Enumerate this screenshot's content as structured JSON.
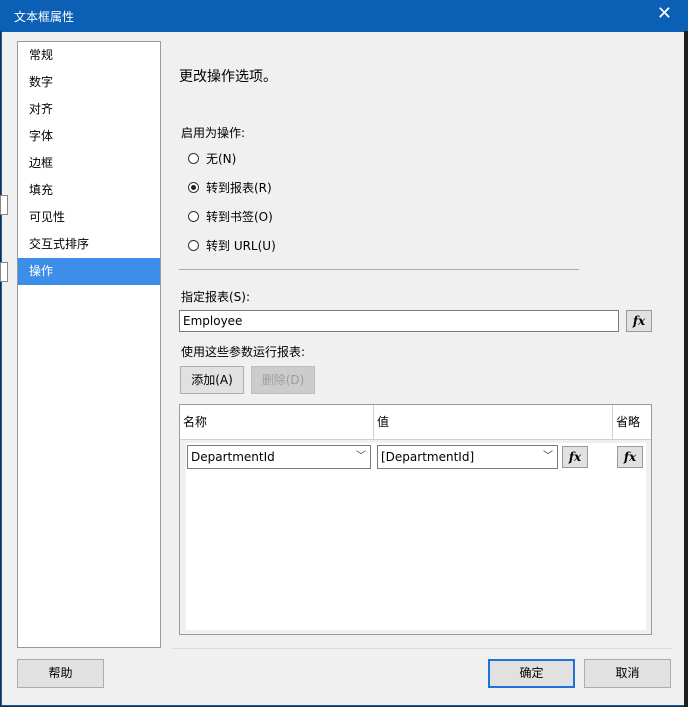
{
  "window": {
    "title": "文本框属性",
    "close_icon": "close-icon"
  },
  "sidebar": {
    "items": [
      {
        "label": "常规"
      },
      {
        "label": "数字"
      },
      {
        "label": "对齐"
      },
      {
        "label": "字体"
      },
      {
        "label": "边框"
      },
      {
        "label": "填充"
      },
      {
        "label": "可见性"
      },
      {
        "label": "交互式排序"
      },
      {
        "label": "操作",
        "selected": true
      }
    ]
  },
  "main": {
    "heading": "更改操作选项。",
    "enable_as_action_label": "启用为操作:",
    "radios": [
      {
        "label": "无(N)",
        "checked": false
      },
      {
        "label": "转到报表(R)",
        "checked": true
      },
      {
        "label": "转到书签(O)",
        "checked": false
      },
      {
        "label": "转到 URL(U)",
        "checked": false
      }
    ],
    "report_label": "指定报表(S):",
    "report_value": "Employee",
    "params_label": "使用这些参数运行报表:",
    "add_button": "添加(A)",
    "delete_button": "删除(D)",
    "grid": {
      "columns": [
        "名称",
        "值",
        "省略"
      ],
      "rows": [
        {
          "name": "DepartmentId",
          "value": "[DepartmentId]"
        }
      ]
    },
    "fx_label": "fx"
  },
  "footer": {
    "help_button": "帮助",
    "ok_button": "确定",
    "cancel_button": "取消"
  },
  "colors": {
    "titlebar": "#0b5fb4",
    "selection": "#3c8ee8",
    "default_button_border": "#1f72d6"
  }
}
